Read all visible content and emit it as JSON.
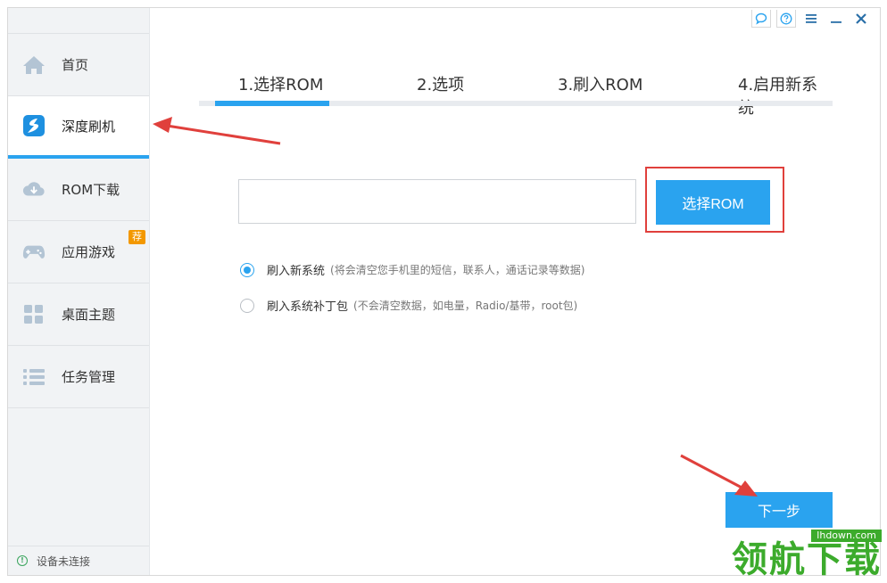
{
  "sidebar": {
    "items": [
      {
        "label": "首页",
        "icon": "home-icon",
        "active": false
      },
      {
        "label": "深度刷机",
        "icon": "flash-icon",
        "active": true
      },
      {
        "label": "ROM下载",
        "icon": "cloud-download-icon",
        "active": false
      },
      {
        "label": "应用游戏",
        "icon": "gamepad-icon",
        "active": false,
        "badge": "荐"
      },
      {
        "label": "桌面主题",
        "icon": "grid-icon",
        "active": false
      },
      {
        "label": "任务管理",
        "icon": "list-icon",
        "active": false
      }
    ],
    "status": "设备未连接"
  },
  "steps": [
    {
      "label": "1.选择ROM"
    },
    {
      "label": "2.选项"
    },
    {
      "label": "3.刷入ROM"
    },
    {
      "label": "4.启用新系统"
    }
  ],
  "rom": {
    "path_value": "",
    "select_button": "选择ROM"
  },
  "options": [
    {
      "label": "刷入新系统",
      "note": "(将会清空您手机里的短信，联系人，通话记录等数据)",
      "checked": true
    },
    {
      "label": "刷入系统补丁包",
      "note": "(不会清空数据，如电量，Radio/基带，root包)",
      "checked": false
    }
  ],
  "next_button": "下一步",
  "watermark": {
    "site": "lhdown.com",
    "brand": "领航下载"
  },
  "colors": {
    "accent": "#2aa3ef",
    "badge": "#f39800",
    "annotation": "#e0403c",
    "watermark": "#3cab2c"
  }
}
